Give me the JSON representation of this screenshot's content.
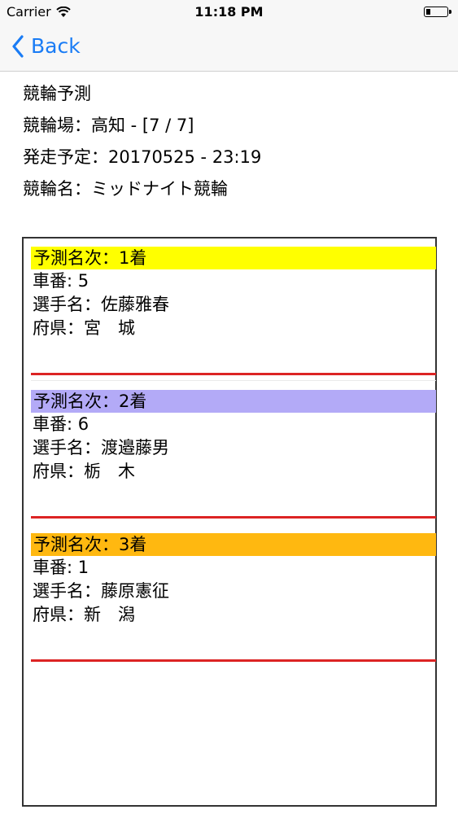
{
  "status": {
    "carrier": "Carrier",
    "time": "11:18 PM",
    "battery_level": 0.2
  },
  "nav": {
    "back_label": "Back"
  },
  "info": {
    "title": "競輪予測",
    "venue": "競輪場：高知 - [7 / 7]",
    "start": "発走予定：20170525 - 23:19",
    "race_name": "競輪名：ミッドナイト競輪"
  },
  "colors": {
    "accent": "#1a7cf5",
    "divider": "#dc2424",
    "rank1": "#ffff00",
    "rank2": "#b3aaf7",
    "rank3": "#ffb810"
  },
  "predictions": [
    {
      "rank": "予測名次：1着",
      "number": "車番: 5",
      "player": "選手名：佐藤雅春",
      "pref": "府県：宮　城",
      "color": "#ffff00"
    },
    {
      "rank": "予測名次：2着",
      "number": "車番: 6",
      "player": "選手名：渡邉藤男",
      "pref": "府県：栃　木",
      "color": "#b3aaf7"
    },
    {
      "rank": "予測名次：3着",
      "number": "車番: 1",
      "player": "選手名：藤原憲征",
      "pref": "府県：新　潟",
      "color": "#ffb810"
    }
  ]
}
